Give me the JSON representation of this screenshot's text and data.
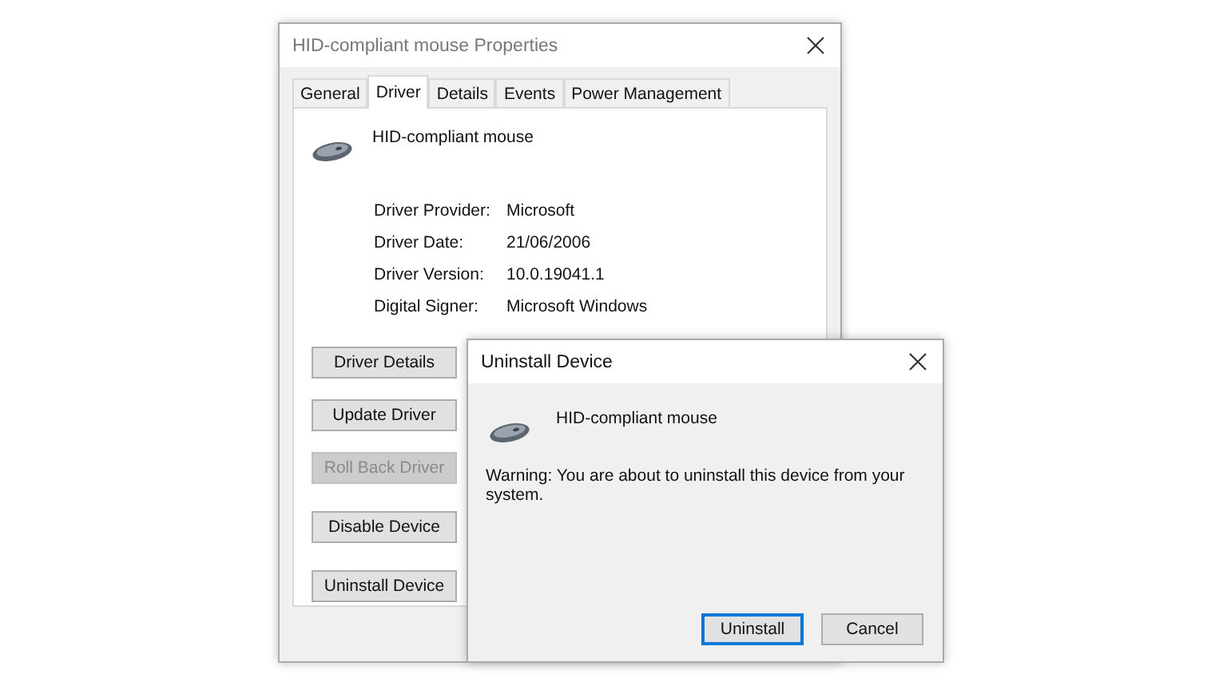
{
  "properties_window": {
    "title": "HID-compliant mouse Properties",
    "tabs": [
      {
        "label": "General",
        "selected": false
      },
      {
        "label": "Driver",
        "selected": true
      },
      {
        "label": "Details",
        "selected": false
      },
      {
        "label": "Events",
        "selected": false
      },
      {
        "label": "Power Management",
        "selected": false
      }
    ],
    "device_name": "HID-compliant mouse",
    "details": [
      {
        "label": "Driver Provider:",
        "value": "Microsoft"
      },
      {
        "label": "Driver Date:",
        "value": "21/06/2006"
      },
      {
        "label": "Driver Version:",
        "value": "10.0.19041.1"
      },
      {
        "label": "Digital Signer:",
        "value": "Microsoft Windows"
      }
    ],
    "buttons": [
      {
        "label": "Driver Details",
        "disabled": false
      },
      {
        "label": "Update Driver",
        "disabled": false
      },
      {
        "label": "Roll Back Driver",
        "disabled": true
      },
      {
        "label": "Disable Device",
        "disabled": false
      },
      {
        "label": "Uninstall Device",
        "disabled": false
      }
    ]
  },
  "uninstall_dialog": {
    "title": "Uninstall Device",
    "device_name": "HID-compliant mouse",
    "warning": "Warning: You are about to uninstall this device from your system.",
    "buttons": [
      {
        "label": "Uninstall",
        "default": true
      },
      {
        "label": "Cancel",
        "default": false
      }
    ]
  }
}
